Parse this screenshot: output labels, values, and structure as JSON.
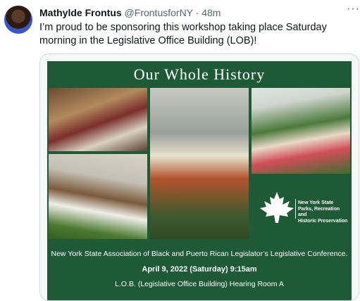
{
  "tweet": {
    "author_name": "Mathylde Frontus",
    "author_handle": "@FrontusforNY",
    "separator": "·",
    "time": "48m",
    "more": "···",
    "text": "I’m proud to be sponsoring this workshop taking place Saturday morning in the Legislative Office Building (LOB)!"
  },
  "poster": {
    "title": "Our Whole History",
    "logo_lines": [
      "New York State",
      "Parks, Recreation and",
      "Historic Preservation"
    ],
    "line1": "New York State Association of Black and Puerto Rican Legislator’s Legislative Conference.",
    "line2": "April 9, 2022 (Saturday) 9:15am",
    "line3": "L.O.B. (Legislative Office Building)  Hearing Room A"
  },
  "colors": {
    "poster_green": "#1f5a37",
    "text": "#0f1419",
    "secondary": "#536471"
  }
}
